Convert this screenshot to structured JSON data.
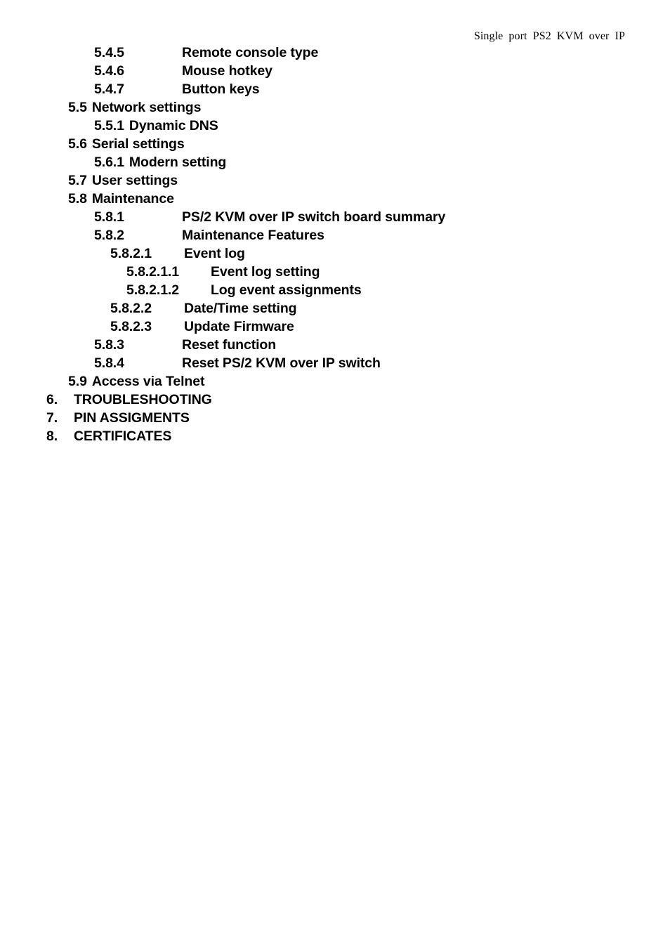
{
  "header": {
    "running_head": "Single port PS2 KVM over IP"
  },
  "toc": {
    "entries": [
      {
        "number": "5.4.5",
        "title": "Remote console type",
        "indent": "lv-sub",
        "tab": "tab-wide"
      },
      {
        "number": "5.4.6",
        "title": "Mouse hotkey",
        "indent": "lv-sub",
        "tab": "tab-wide"
      },
      {
        "number": "5.4.7",
        "title": "Button keys",
        "indent": "lv-sub",
        "tab": "tab-wide"
      },
      {
        "number": "5.5",
        "title": "Network settings",
        "indent": "lv-sec",
        "tab": "tab-space"
      },
      {
        "number": "5.5.1",
        "title": "Dynamic DNS",
        "indent": "lv-sub",
        "tab": "tab-space"
      },
      {
        "number": "5.6",
        "title": "Serial settings",
        "indent": "lv-sec",
        "tab": "tab-space"
      },
      {
        "number": "5.6.1",
        "title": "Modern setting",
        "indent": "lv-sub",
        "tab": "tab-space"
      },
      {
        "number": "5.7",
        "title": "User settings",
        "indent": "lv-sec",
        "tab": "tab-space"
      },
      {
        "number": "5.8",
        "title": "Maintenance",
        "indent": "lv-sec",
        "tab": "tab-space"
      },
      {
        "number": "5.8.1",
        "title": "PS/2 KVM over IP switch board summary",
        "indent": "lv-sub",
        "tab": "tab-wide"
      },
      {
        "number": "5.8.2",
        "title": "Maintenance Features",
        "indent": "lv-sub",
        "tab": "tab-wide"
      },
      {
        "number": "5.8.2.1",
        "title": "Event log",
        "indent": "lv-sub3",
        "tab": "tab-mid"
      },
      {
        "number": "5.8.2.1.1",
        "title": "Event log setting",
        "indent": "lv-sub4",
        "tab": "tab-deep"
      },
      {
        "number": "5.8.2.1.2",
        "title": "Log event assignments",
        "indent": "lv-sub4",
        "tab": "tab-deep"
      },
      {
        "number": "5.8.2.2",
        "title": "Date/Time setting",
        "indent": "lv-sub3",
        "tab": "tab-mid"
      },
      {
        "number": "5.8.2.3",
        "title": "Update Firmware",
        "indent": "lv-sub3",
        "tab": "tab-mid"
      },
      {
        "number": "5.8.3",
        "title": "Reset function",
        "indent": "lv-sub",
        "tab": "tab-wide"
      },
      {
        "number": "5.8.4",
        "title": "Reset PS/2 KVM over IP switch",
        "indent": "lv-sub",
        "tab": "tab-wide"
      },
      {
        "number": "5.9",
        "title": "Access via Telnet",
        "indent": "lv-sec",
        "tab": "tab-space"
      },
      {
        "number": "6.",
        "title": "TROUBLESHOOTING",
        "indent": "lv-top",
        "tab": "tab-top"
      },
      {
        "number": "7.",
        "title": "PIN ASSIGMENTS",
        "indent": "lv-top",
        "tab": "tab-top"
      },
      {
        "number": "8.",
        "title": "CERTIFICATES",
        "indent": "lv-top",
        "tab": "tab-top"
      }
    ]
  }
}
